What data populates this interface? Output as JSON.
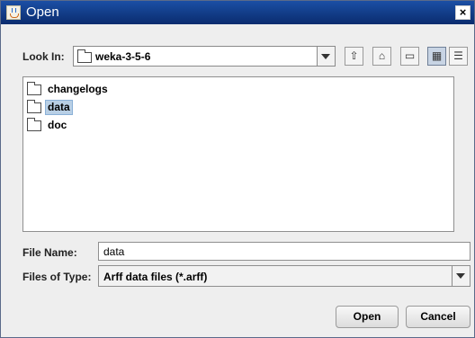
{
  "window": {
    "title": "Open"
  },
  "look_in": {
    "label": "Look In:",
    "value": "weka-3-5-6"
  },
  "toolbar": {
    "icons": [
      "up-folder-icon",
      "home-icon",
      "new-folder-icon",
      "list-view-icon",
      "details-view-icon"
    ]
  },
  "files": [
    {
      "name": "changelogs"
    },
    {
      "name": "data"
    },
    {
      "name": "doc"
    }
  ],
  "file_name": {
    "label": "File Name:",
    "value": "data"
  },
  "file_type": {
    "label": "Files of Type:",
    "value": "Arff data files (*.arff)"
  },
  "buttons": {
    "open": "Open",
    "cancel": "Cancel"
  }
}
